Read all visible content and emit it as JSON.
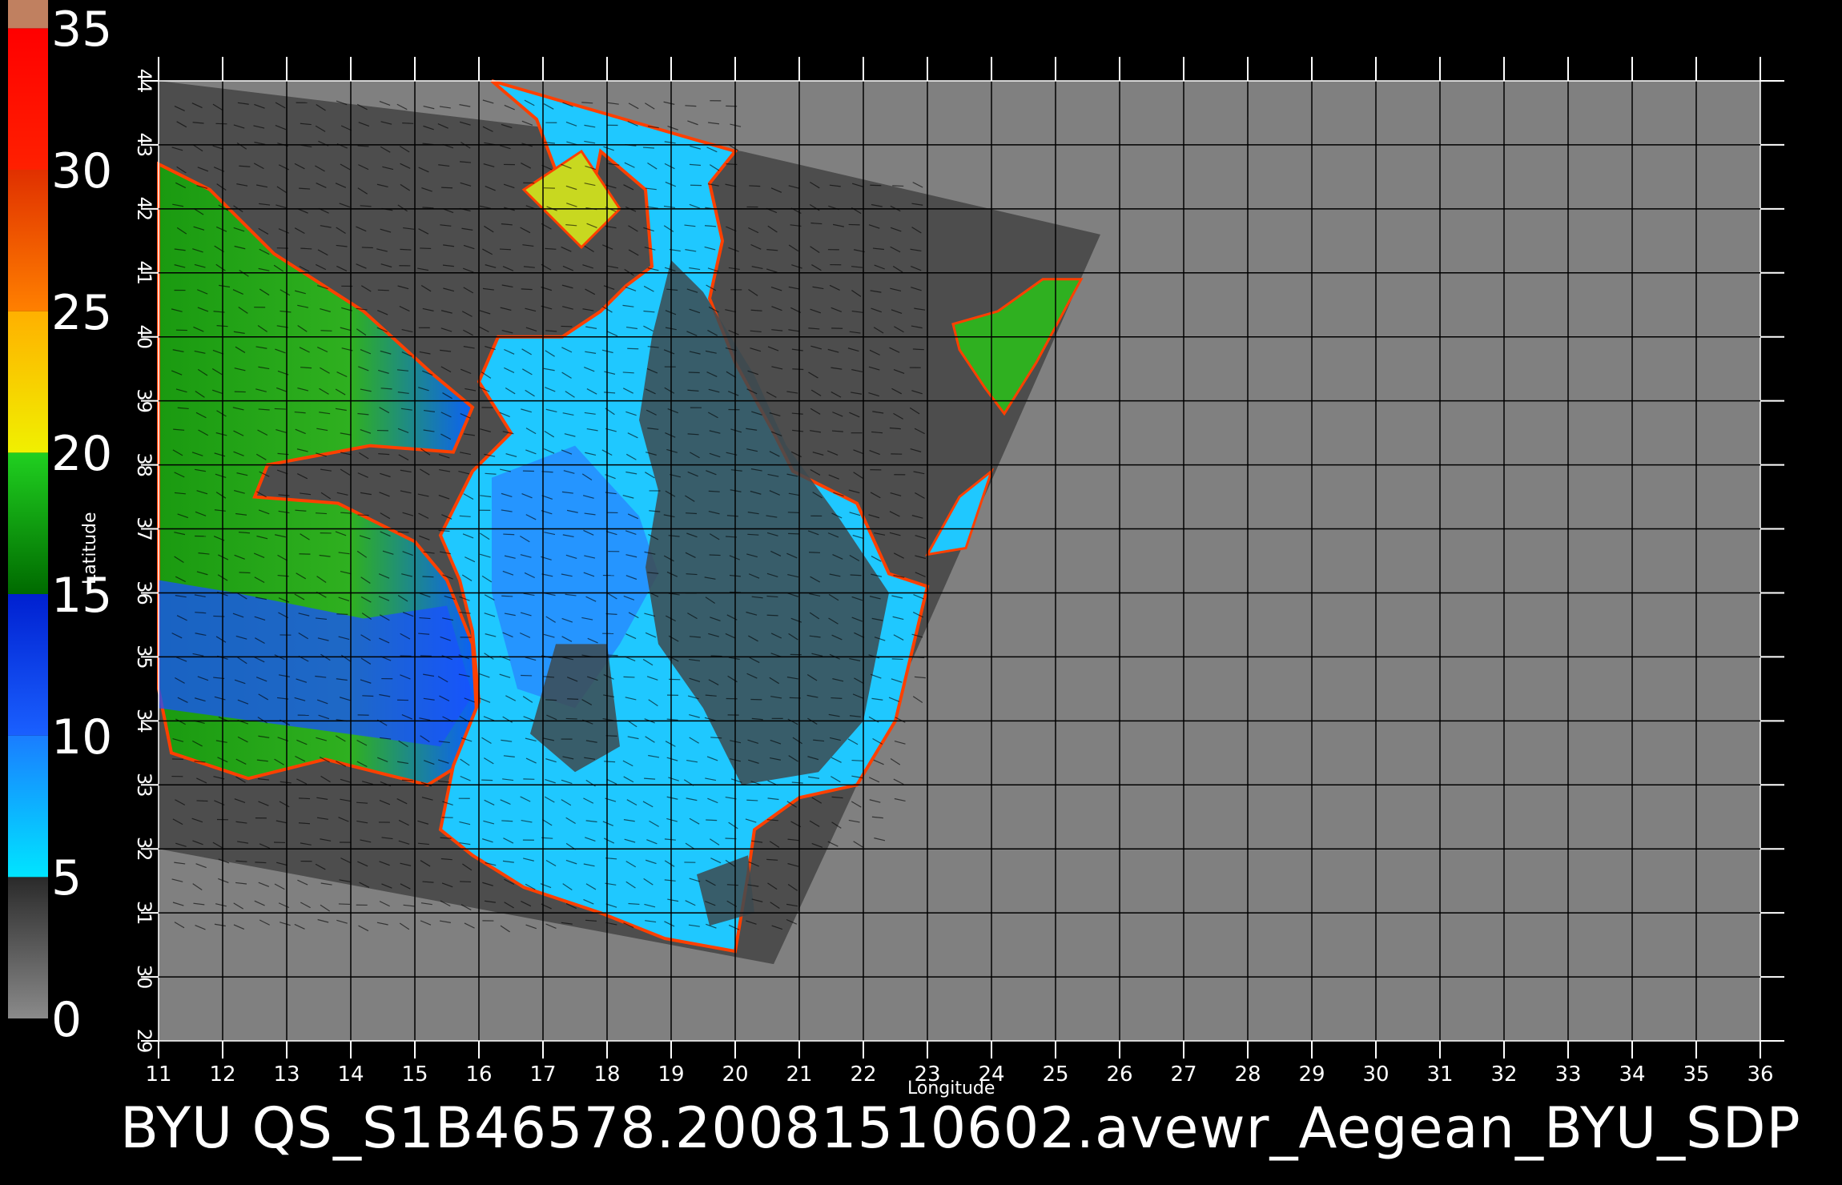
{
  "footer": {
    "text": "BYU  QS_S1B46578.20081510602.avewr_Aegean_BYU_SDP"
  },
  "colorbar": {
    "labels": [
      "35",
      "30",
      "25",
      "20",
      "15",
      "10",
      "5",
      "0"
    ],
    "stops": [
      {
        "from": 0,
        "to": 5,
        "colors": [
          "#8a8a8a",
          "#2a2a2a"
        ]
      },
      {
        "from": 5,
        "to": 10,
        "colors": [
          "#00e5ff",
          "#1a7dff"
        ]
      },
      {
        "from": 10,
        "to": 15,
        "colors": [
          "#1a60ff",
          "#0020d0"
        ]
      },
      {
        "from": 15,
        "to": 20,
        "colors": [
          "#006a00",
          "#20d020"
        ]
      },
      {
        "from": 20,
        "to": 25,
        "colors": [
          "#f0f000",
          "#ffb000"
        ]
      },
      {
        "from": 25,
        "to": 30,
        "colors": [
          "#ff8000",
          "#e03000"
        ]
      },
      {
        "from": 30,
        "to": 35,
        "colors": [
          "#ff2000",
          "#ff0000"
        ]
      },
      {
        "from": 35,
        "to": 36,
        "colors": [
          "#c08060",
          "#c08060"
        ]
      }
    ]
  },
  "map_data": {
    "type": "wind-speed-map",
    "x_axis": {
      "title": "Longitude",
      "ticks": [
        "11",
        "12",
        "13",
        "14",
        "15",
        "16",
        "17",
        "18",
        "19",
        "20",
        "21",
        "22",
        "23",
        "24",
        "25",
        "26",
        "27",
        "28",
        "29",
        "30",
        "31",
        "32",
        "33",
        "34",
        "35",
        "36"
      ]
    },
    "y_axis": {
      "title": "Latitude",
      "ticks": [
        "29",
        "30",
        "31",
        "32",
        "33",
        "34",
        "35",
        "36",
        "37",
        "38",
        "39",
        "40",
        "41",
        "42",
        "43",
        "44"
      ]
    },
    "lon_range": [
      11,
      36
    ],
    "lat_range": [
      29,
      44
    ],
    "grid": true,
    "colors": {
      "no_data": "#808080",
      "land": "#4d4d4d",
      "grid": "#000000"
    }
  }
}
